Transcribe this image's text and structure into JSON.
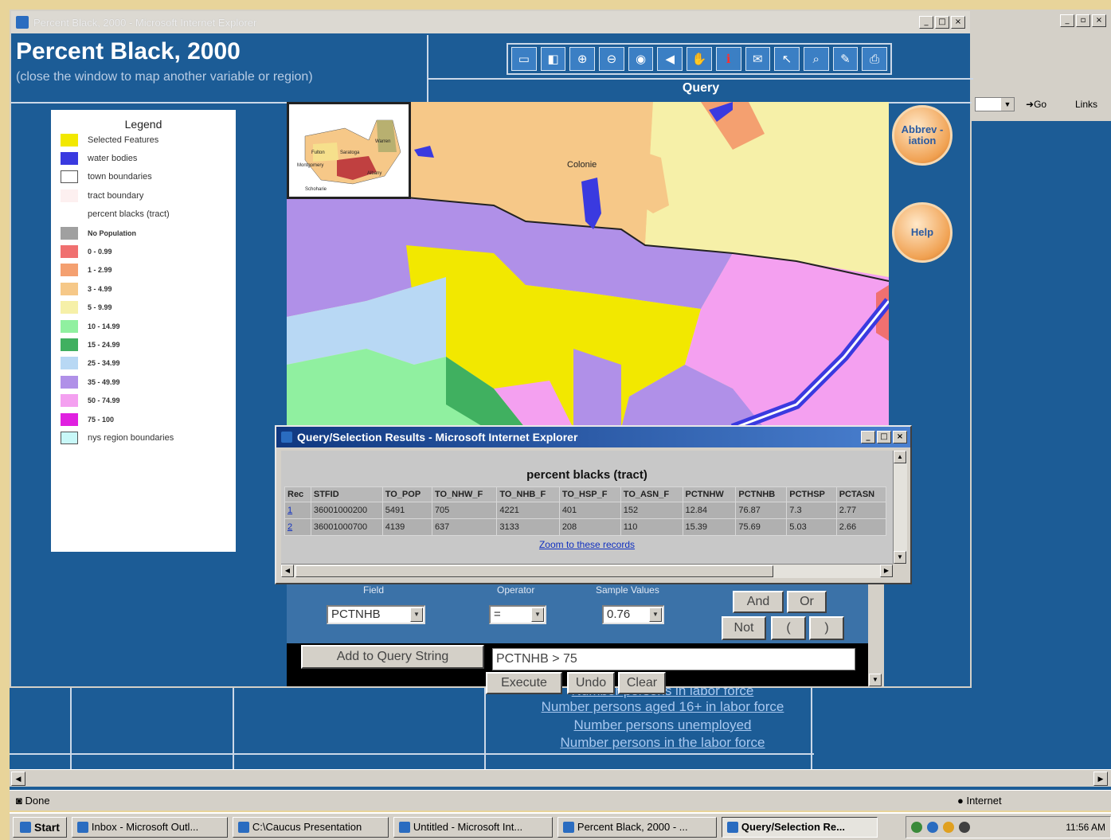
{
  "main_window": {
    "title": "Percent Black, 2000 - Microsoft Internet Explorer",
    "controls": [
      "_",
      "□",
      "×"
    ]
  },
  "page": {
    "title": "Percent Black, 2000",
    "subtitle": "(close the window to map another variable or region)",
    "query_label": "Query"
  },
  "toolbar": {
    "tools": [
      {
        "icon": "overview-icon",
        "glyph": "▭"
      },
      {
        "icon": "layers-icon",
        "glyph": "◧"
      },
      {
        "icon": "zoom-in-icon",
        "glyph": "⊕"
      },
      {
        "icon": "zoom-out-icon",
        "glyph": "⊖"
      },
      {
        "icon": "zoom-extent-icon",
        "glyph": "◉"
      },
      {
        "icon": "back-icon",
        "glyph": "◀"
      },
      {
        "icon": "pan-icon",
        "glyph": "✋"
      },
      {
        "icon": "identify-icon",
        "glyph": "ℹ"
      },
      {
        "icon": "query-icon",
        "glyph": "✉"
      },
      {
        "icon": "select-icon",
        "glyph": "↖"
      },
      {
        "icon": "find-icon",
        "glyph": "⌕"
      },
      {
        "icon": "measure-icon",
        "glyph": "✎"
      },
      {
        "icon": "print-icon",
        "glyph": "⎙"
      }
    ]
  },
  "legend": {
    "title": "Legend",
    "items": [
      {
        "label": "Selected Features",
        "color": "#f2e800",
        "outline": false
      },
      {
        "label": "water bodies",
        "color": "#3a3ae0",
        "outline": false
      },
      {
        "label": "town boundaries",
        "color": "#ffffff",
        "outline": true
      },
      {
        "label": "tract boundary",
        "color": "#fdf0f0",
        "outline": false
      },
      {
        "label": "percent blacks (tract)",
        "color": "",
        "outline": false
      },
      {
        "label": "No Population",
        "color": "#a0a0a0",
        "outline": false,
        "small": true
      },
      {
        "label": "0 - 0.99",
        "color": "#f07070",
        "outline": false,
        "small": true
      },
      {
        "label": "1 - 2.99",
        "color": "#f4a070",
        "outline": false,
        "small": true
      },
      {
        "label": "3 - 4.99",
        "color": "#f6c888",
        "outline": false,
        "small": true
      },
      {
        "label": "5 - 9.99",
        "color": "#f6f0a8",
        "outline": false,
        "small": true
      },
      {
        "label": "10 - 14.99",
        "color": "#90f0a0",
        "outline": false,
        "small": true
      },
      {
        "label": "15 - 24.99",
        "color": "#40b060",
        "outline": false,
        "small": true
      },
      {
        "label": "25 - 34.99",
        "color": "#b8d8f4",
        "outline": false,
        "small": true
      },
      {
        "label": "35 - 49.99",
        "color": "#b090e8",
        "outline": false,
        "small": true
      },
      {
        "label": "50 - 74.99",
        "color": "#f4a0f0",
        "outline": false,
        "small": true
      },
      {
        "label": "75 - 100",
        "color": "#e020e0",
        "outline": false,
        "small": true
      },
      {
        "label": "nys region boundaries",
        "color": "#c8f8f8",
        "outline": true
      }
    ]
  },
  "map": {
    "labels": {
      "colonie": "Colonie"
    },
    "inset_labels": [
      "Fulton",
      "Saratoga",
      "Montgomery",
      "Schoharie",
      "Albany",
      "Warren"
    ]
  },
  "side_buttons": {
    "abbreviation": "Abbrev -iation",
    "help": "Help"
  },
  "popup": {
    "title": "Query/Selection Results - Microsoft Internet Explorer",
    "caption": "percent blacks (tract)",
    "columns": [
      "Rec",
      "STFID",
      "TO_POP",
      "TO_NHW_F",
      "TO_NHB_F",
      "TO_HSP_F",
      "TO_ASN_F",
      "PCTNHW",
      "PCTNHB",
      "PCTHSP",
      "PCTASN"
    ],
    "rows": [
      [
        "1",
        "36001000200",
        "5491",
        "705",
        "4221",
        "401",
        "152",
        "12.84",
        "76.87",
        "7.3",
        "2.77"
      ],
      [
        "2",
        "36001000700",
        "4139",
        "637",
        "3133",
        "208",
        "110",
        "15.39",
        "75.69",
        "5.03",
        "2.66"
      ]
    ],
    "zoom_link": "Zoom to these records"
  },
  "query_form": {
    "field_label": "Field",
    "operator_label": "Operator",
    "sample_label": "Sample Values",
    "field_value": "PCTNHB",
    "operator_value": "=",
    "sample_value": "0.76",
    "and_label": "And",
    "or_label": "Or",
    "not_label": "Not",
    "open_paren": "(",
    "close_paren": ")",
    "add_button": "Add to Query String",
    "query_string": "PCTNHB  >  75",
    "execute": "Execute",
    "undo": "Undo",
    "clear": "Clear"
  },
  "under_page": {
    "links": [
      "Number persons in labor force",
      "Number persons aged 16+ in labor force",
      "Number persons unemployed",
      "Number persons in the labor force"
    ]
  },
  "background_window": {
    "go": "Go",
    "links": "Links"
  },
  "status": {
    "text": "Done",
    "zone": "Internet"
  },
  "taskbar": {
    "start": "Start",
    "items": [
      {
        "label": "Inbox - Microsoft Outl...",
        "active": false
      },
      {
        "label": "C:\\Caucus Presentation",
        "active": false
      },
      {
        "label": "Untitled - Microsoft Int...",
        "active": false
      },
      {
        "label": "Percent Black, 2000 - ...",
        "active": false
      },
      {
        "label": "Query/Selection Re...",
        "active": true
      }
    ],
    "clock": "11:56 AM"
  }
}
